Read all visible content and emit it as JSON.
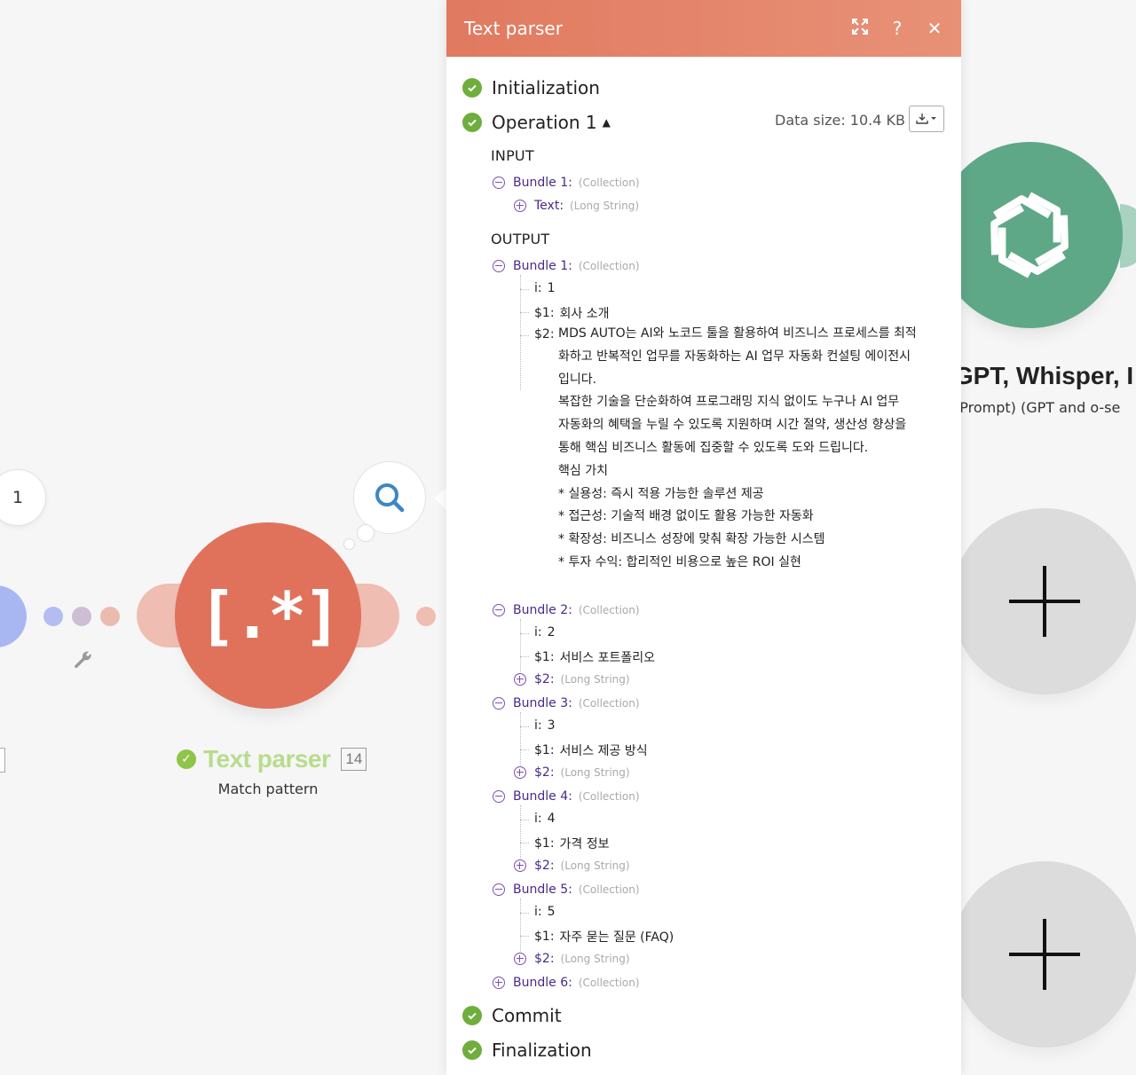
{
  "canvas": {
    "left_bubble_label": "1",
    "text_parser_module": {
      "icon_text": "[.*]",
      "name": "Text parser",
      "operations_count": "14",
      "subtitle": "Match pattern"
    },
    "openai_module": {
      "title": "atGPT, Whisper, I",
      "subtitle": "on (Prompt) (GPT and o-se"
    },
    "colors": {
      "text_parser": "#e0725c",
      "openai": "#5ea888",
      "success": "#6fae3c"
    }
  },
  "panel": {
    "title": "Text parser",
    "header_icons": [
      "expand-icon",
      "help-icon",
      "close-icon"
    ],
    "help_glyph": "?",
    "close_glyph": "✕",
    "stages": {
      "initialization": "Initialization",
      "operation": "Operation 1",
      "commit": "Commit",
      "finalization": "Finalization"
    },
    "data_size": "Data size: 10.4 KB",
    "input_label": "INPUT",
    "output_label": "OUTPUT",
    "input": {
      "bundle_key": "Bundle 1:",
      "bundle_type": "(Collection)",
      "text_key": "Text:",
      "text_type": "(Long String)"
    },
    "output": {
      "b1": {
        "key": "Bundle 1:",
        "type": "(Collection)",
        "i_key": "i:",
        "i_val": "1",
        "s1_key": "$1:",
        "s1_val": "회사 소개",
        "s2_key": "$2:",
        "s2_val": "MDS AUTO는 AI와 노코드 툴을 활용하여 비즈니스 프로세스를 최적\n화하고 반복적인 업무를 자동화하는 AI 업무 자동화 컨설팅 에이전시\n입니다.\n복잡한 기술을 단순화하여 프로그래밍 지식 없이도 누구나 AI 업무\n자동화의 혜택을 누릴 수 있도록 지원하며 시간 절약, 생산성 향상을\n통해 핵심 비즈니스 활동에 집중할 수 있도록 도와 드립니다.\n핵심 가치\n* 실용성: 즉시 적용 가능한 솔루션 제공\n* 접근성: 기술적 배경 없이도 활용 가능한 자동화\n* 확장성: 비즈니스 성장에 맞춰 확장 가능한 시스템\n* 투자 수익: 합리적인 비용으로 높은 ROI 실현"
      },
      "b2": {
        "key": "Bundle 2:",
        "type": "(Collection)",
        "i_key": "i:",
        "i_val": "2",
        "s1_key": "$1:",
        "s1_val": "서비스 포트폴리오",
        "s2_key": "$2:",
        "s2_type": "(Long String)"
      },
      "b3": {
        "key": "Bundle 3:",
        "type": "(Collection)",
        "i_key": "i:",
        "i_val": "3",
        "s1_key": "$1:",
        "s1_val": "서비스 제공 방식",
        "s2_key": "$2:",
        "s2_type": "(Long String)"
      },
      "b4": {
        "key": "Bundle 4:",
        "type": "(Collection)",
        "i_key": "i:",
        "i_val": "4",
        "s1_key": "$1:",
        "s1_val": "가격 정보",
        "s2_key": "$2:",
        "s2_type": "(Long String)"
      },
      "b5": {
        "key": "Bundle 5:",
        "type": "(Collection)",
        "i_key": "i:",
        "i_val": "5",
        "s1_key": "$1:",
        "s1_val": "자주 묻는 질문 (FAQ)",
        "s2_key": "$2:",
        "s2_type": "(Long String)"
      },
      "b6": {
        "key": "Bundle 6:",
        "type": "(Collection)"
      }
    }
  }
}
